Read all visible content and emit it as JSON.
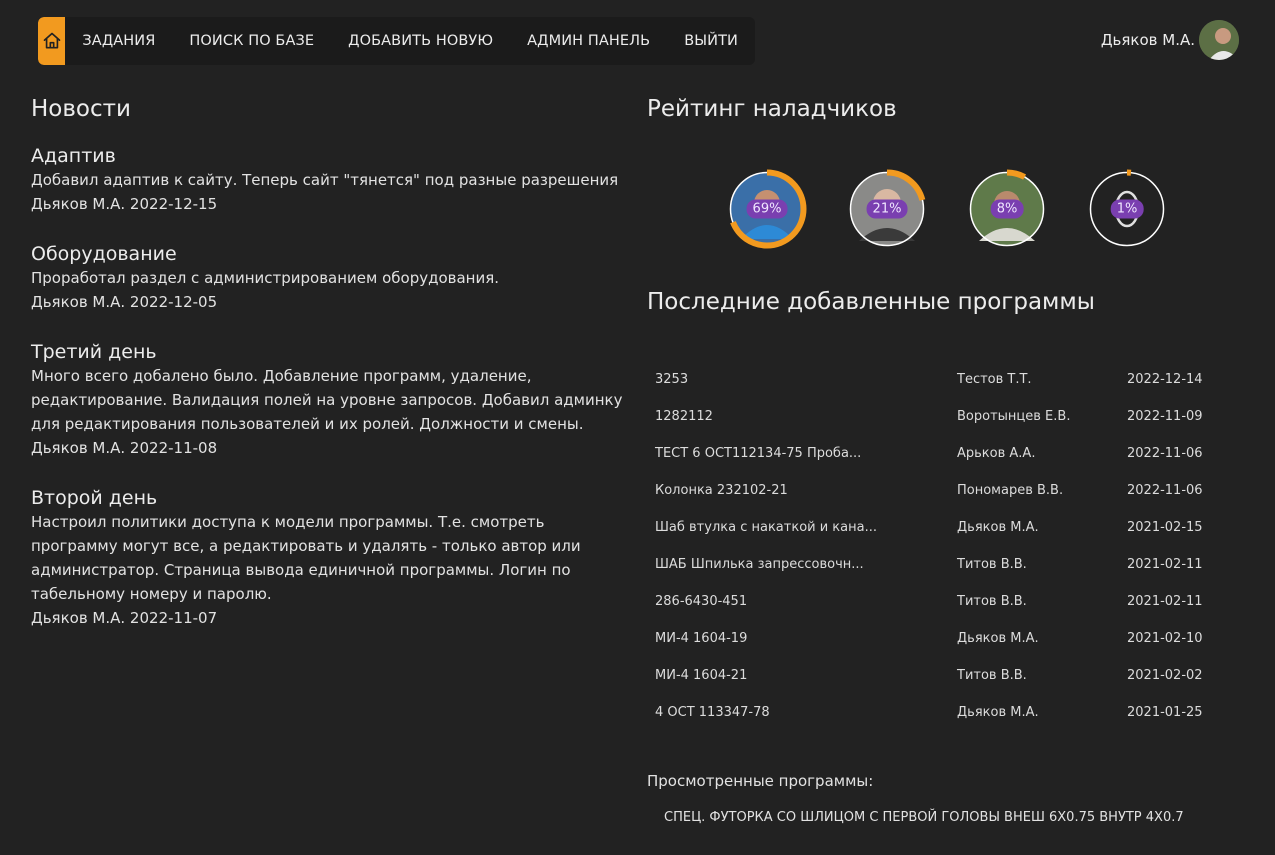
{
  "nav": {
    "home_icon": "home-icon",
    "items": [
      "ЗАДАНИЯ",
      "ПОИСК ПО БАЗЕ",
      "ДОБАВИТЬ НОВУЮ",
      "АДМИН ПАНЕЛЬ",
      "ВЫЙТИ"
    ],
    "accent_color": "#f29a1f"
  },
  "user": {
    "name": "Дьяков М.А."
  },
  "news": {
    "title": "Новости",
    "items": [
      {
        "title": "Адаптив",
        "text": "Добавил адаптив к сайту. Теперь сайт \"тянется\" под разные разрешения",
        "meta": "Дьяков М.А. 2022-12-15"
      },
      {
        "title": "Оборудование",
        "text": "Проработал раздел с администрированием оборудования.",
        "meta": "Дьяков М.А. 2022-12-05"
      },
      {
        "title": "Третий день",
        "text": "Много всего добалено было. Добавление программ, удаление, редактирование. Валидация полей на уровне запросов. Добавил админку для редактирования пользователей и их ролей. Должности и смены.",
        "meta": "Дьяков М.А. 2022-11-08"
      },
      {
        "title": "Второй день",
        "text": "Настроил политики доступа к модели программы. Т.е. смотреть программу могут все, а редактировать и удалять - только автор или администратор. Страница вывода единичной программы. Логин по табельному номеру и паролю.",
        "meta": "Дьяков М.А. 2022-11-07"
      }
    ]
  },
  "rating": {
    "title": "Рейтинг наладчиков",
    "items": [
      {
        "percent_label": "69%",
        "value": 69
      },
      {
        "percent_label": "21%",
        "value": 21
      },
      {
        "percent_label": "8%",
        "value": 8
      },
      {
        "percent_label": "1%",
        "value": 1
      }
    ]
  },
  "programs": {
    "title": "Последние добавленные программы",
    "rows": [
      {
        "name": "3253",
        "author": "Тестов Т.Т.",
        "date": "2022-12-14"
      },
      {
        "name": "1282112",
        "author": "Воротынцев Е.В.",
        "date": "2022-11-09"
      },
      {
        "name": "ТЕСТ 6 ОСТ112134-75 Проба...",
        "author": "Арьков А.А.",
        "date": "2022-11-06"
      },
      {
        "name": "Колонка 232102-21",
        "author": "Пономарев В.В.",
        "date": "2022-11-06"
      },
      {
        "name": "Шаб втулка с накаткой и кана...",
        "author": "Дьяков М.А.",
        "date": "2021-02-15"
      },
      {
        "name": "ШАБ Шпилька запрессовочн...",
        "author": "Титов В.В.",
        "date": "2021-02-11"
      },
      {
        "name": "286-6430-451",
        "author": "Титов В.В.",
        "date": "2021-02-11"
      },
      {
        "name": "МИ-4 1604-19",
        "author": "Дьяков М.А.",
        "date": "2021-02-10"
      },
      {
        "name": "МИ-4 1604-21",
        "author": "Титов В.В.",
        "date": "2021-02-02"
      },
      {
        "name": "4 ОСТ 113347-78",
        "author": "Дьяков М.А.",
        "date": "2021-01-25"
      }
    ]
  },
  "viewed": {
    "label": "Просмотренные программы:",
    "items": [
      "СПЕЦ. ФУТОРКА СО ШЛИЦОМ С ПЕРВОЙ ГОЛОВЫ ВНЕШ 6Х0.75 ВНУТР 4Х0.7"
    ]
  }
}
